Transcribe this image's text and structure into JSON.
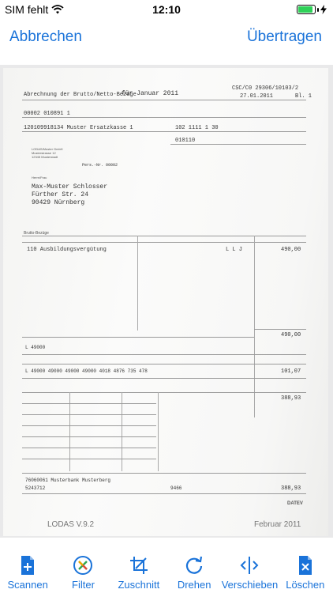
{
  "status_bar": {
    "carrier": "SIM fehlt",
    "time": "12:10"
  },
  "nav": {
    "cancel_label": "Abbrechen",
    "transfer_label": "Übertragen"
  },
  "document": {
    "title": "Abrechnung der Brutto/Netto-Bezüge",
    "period": "für Januar 2011",
    "code": "CSC/C0  29306/10103/2",
    "date": "27.01.2011",
    "sheet": "Bl. 1",
    "pers_no": "00002 010891 1",
    "kasse": "120109918134 Muster Ersatzkasse 1",
    "kasse_no": "102 1111 1 30",
    "group": "010110",
    "employer_line1": "LODAS/Muster GmbH",
    "employer_line2": "Musterstrasse 12",
    "employer_line3": "12345 Musterstadt",
    "pers_nr_label": "Pers.-Nr. 00002",
    "recipient_title": "Herrn/Frau",
    "recipient_name": "Max-Muster Schlosser",
    "recipient_street": "Fürther Str. 24",
    "recipient_city": "90429 Nürnberg",
    "bezuege_label": "Brutto-Bezüge",
    "item_line": "110 Ausbildungsvergütung",
    "item_flags": "L  L  J",
    "item_amount": "490,00",
    "gesamt_brutto": "490,00",
    "tax_row": "L      49000",
    "sv_row": "L  49000  49000  49000  49000  4018  4876  735  478",
    "sv_total": "101,07",
    "netto": "388,93",
    "bank": "76060061 Musterbank Musterberg",
    "account": "5243712",
    "account_value": "9466",
    "payout": "388,93",
    "software": "LODAS V.9.2",
    "month": "Februar 2011",
    "brand": "DATEV"
  },
  "tabs": [
    {
      "label": "Scannen",
      "icon": "scan-document-icon"
    },
    {
      "label": "Filter",
      "icon": "filter-icon"
    },
    {
      "label": "Zuschnitt",
      "icon": "crop-icon"
    },
    {
      "label": "Drehen",
      "icon": "rotate-icon"
    },
    {
      "label": "Verschieben",
      "icon": "move-icon"
    },
    {
      "label": "Löschen",
      "icon": "delete-document-icon"
    }
  ],
  "colors": {
    "accent": "#1a73d9",
    "battery": "#2fd158"
  }
}
